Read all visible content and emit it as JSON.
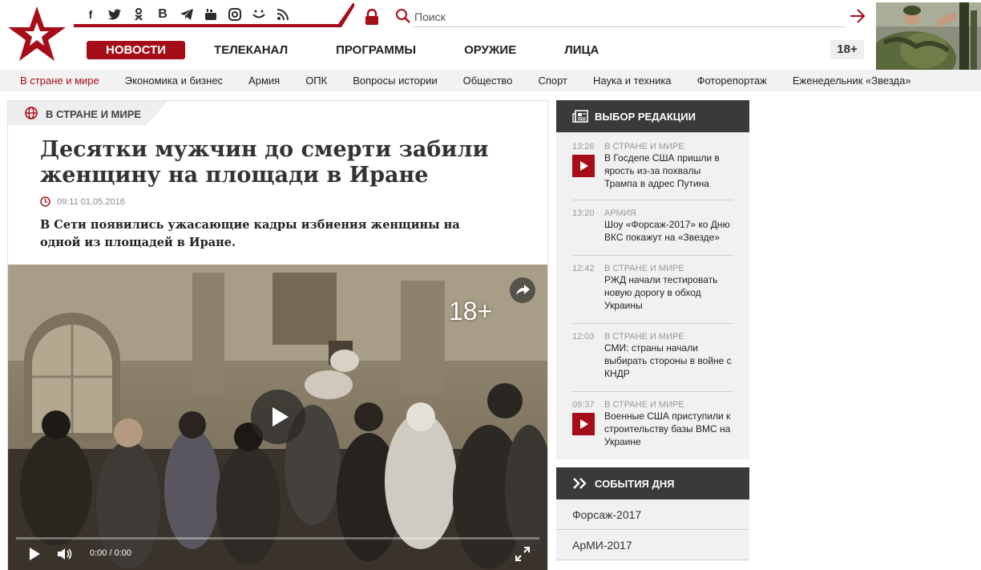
{
  "header": {
    "social_icons": [
      "facebook-icon",
      "twitter-icon",
      "odnoklassniki-icon",
      "vk-icon",
      "telegram-icon",
      "youtube-icon",
      "instagram-icon",
      "yandex-zen-icon",
      "rss-icon"
    ],
    "search": {
      "placeholder": "Поиск"
    },
    "main_nav": [
      "НОВОСТИ",
      "ТЕЛЕКАНАЛ",
      "ПРОГРАММЫ",
      "ОРУЖИЕ",
      "ЛИЦА"
    ],
    "age_badge": "18+",
    "accent_color": "#a50d18"
  },
  "subnav": [
    "В стране и мире",
    "Экономика и бизнес",
    "Армия",
    "ОПК",
    "Вопросы истории",
    "Общество",
    "Спорт",
    "Наука и техника",
    "Фоторепортаж",
    "Еженедельник «Звезда»"
  ],
  "article": {
    "rubric": "В СТРАНЕ И МИРЕ",
    "title": "Десятки мужчин до смерти забили женщину на площади в Иране",
    "date": "09:11 01.05.2016",
    "lead": "В Сети появились ужасающие кадры избиения женщины на одной из площадей в Иране.",
    "video": {
      "age_mark": "18+",
      "time": "0:00 / 0:00"
    }
  },
  "sidebar": {
    "editor_choice_title": "ВЫБОР РЕДАКЦИИ",
    "items": [
      {
        "time": "13:26",
        "rubric": "В СТРАНЕ И МИРЕ",
        "title": "В Госдепе США пришли в ярость из-за похвалы Трампа в адрес Путина",
        "video": true
      },
      {
        "time": "13:20",
        "rubric": "АРМИЯ",
        "title": "Шоу «Форсаж-2017» ко Дню ВКС покажут на «Звезде»",
        "video": false
      },
      {
        "time": "12:42",
        "rubric": "В СТРАНЕ И МИРЕ",
        "title": "РЖД начали тестировать новую дорогу в обход Украины",
        "video": false
      },
      {
        "time": "12:03",
        "rubric": "В СТРАНЕ И МИРЕ",
        "title": "СМИ: страны начали выбирать стороны в войне с КНДР",
        "video": false
      },
      {
        "time": "09:37",
        "rubric": "В СТРАНЕ И МИРЕ",
        "title": "Военные США приступили к строительству базы ВМС на Украине",
        "video": true
      }
    ],
    "events_title": "СОБЫТИЯ ДНЯ",
    "events": [
      "Форсаж-2017",
      "АрМИ-2017"
    ]
  }
}
